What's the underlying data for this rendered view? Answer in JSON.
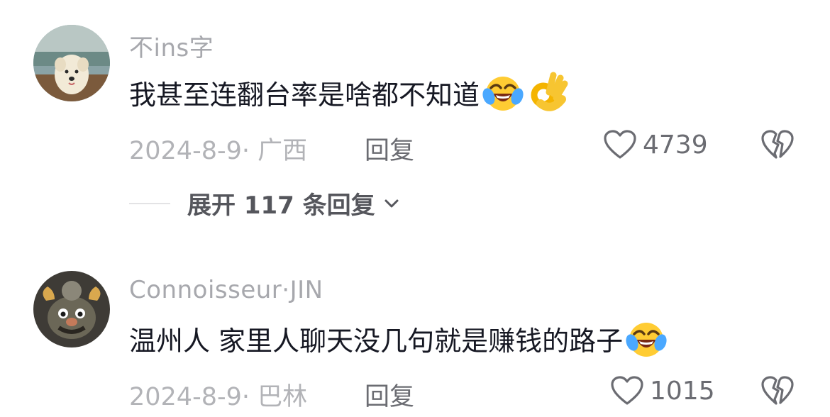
{
  "comments": [
    {
      "username": "不ins字",
      "text": "我甚至连翻台率是啥都不知道",
      "emojis": [
        "laughing-crying-emoji",
        "ok-hand-emoji"
      ],
      "meta": "2024-8-9· 广西",
      "reply_label": "回复",
      "likes": "4739",
      "avatar": "dog-photo-avatar"
    },
    {
      "username": "Connoisseur·JIN",
      "text": "温州人 家里人聊天没几句就是赚钱的路子",
      "emojis": [
        "laughing-crying-emoji"
      ],
      "meta": "2024-8-9· 巴林",
      "reply_label": "回复",
      "likes": "1015",
      "avatar": "cartoon-character-avatar"
    }
  ],
  "expand_replies": {
    "label": "展开 117 条回复"
  },
  "colors": {
    "text_primary": "#161823",
    "text_secondary": "#a7a8ad",
    "action_gray": "#6b6c72"
  }
}
